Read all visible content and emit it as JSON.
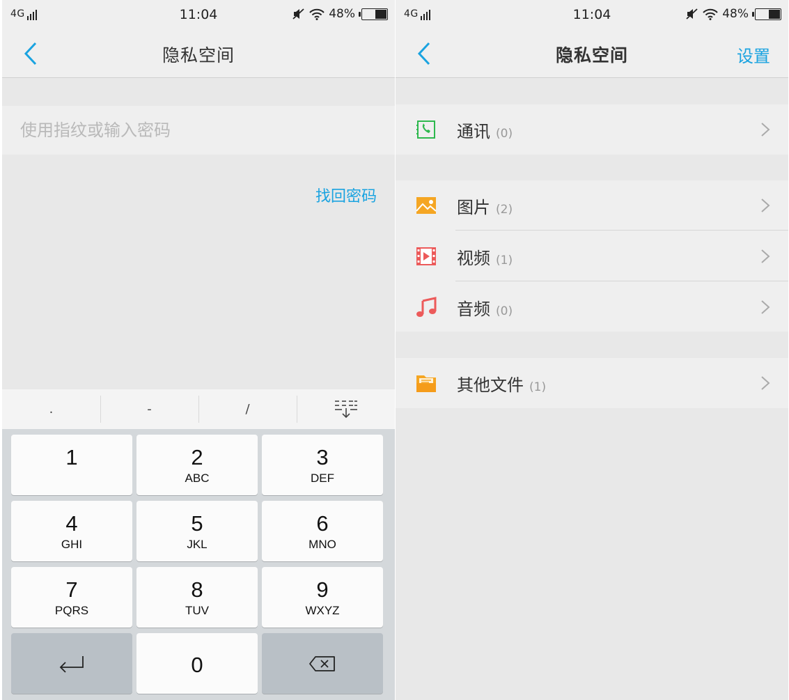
{
  "status_bar": {
    "network": "4G",
    "time": "11:04",
    "battery": "48%",
    "battery_level": 0.48
  },
  "left": {
    "title": "隐私空间",
    "password_placeholder": "使用指纹或输入密码",
    "forgot_link": "找回密码",
    "symbols": [
      ".",
      "-",
      "/"
    ],
    "keys": [
      {
        "num": "1",
        "letters": ""
      },
      {
        "num": "2",
        "letters": "ABC"
      },
      {
        "num": "3",
        "letters": "DEF"
      },
      {
        "num": "4",
        "letters": "GHI"
      },
      {
        "num": "5",
        "letters": "JKL"
      },
      {
        "num": "6",
        "letters": "MNO"
      },
      {
        "num": "7",
        "letters": "PQRS"
      },
      {
        "num": "8",
        "letters": "TUV"
      },
      {
        "num": "9",
        "letters": "WXYZ"
      }
    ],
    "zero_key": "0"
  },
  "right": {
    "title": "隐私空间",
    "settings_label": "设置",
    "items": [
      {
        "label": "通讯",
        "count": "(0)",
        "icon": "contacts-icon",
        "color": "#2db84d"
      },
      {
        "label": "图片",
        "count": "(2)",
        "icon": "image-icon",
        "color": "#f5a623"
      },
      {
        "label": "视频",
        "count": "(1)",
        "icon": "video-icon",
        "color": "#ec5a5a"
      },
      {
        "label": "音频",
        "count": "(0)",
        "icon": "music-icon",
        "color": "#ec5a5a"
      },
      {
        "label": "其他文件",
        "count": "(1)",
        "icon": "folder-icon",
        "color": "#f5a623"
      }
    ]
  },
  "colors": {
    "accent": "#1aa3e0",
    "background": "#e8e8e8",
    "surface": "#efefef"
  }
}
